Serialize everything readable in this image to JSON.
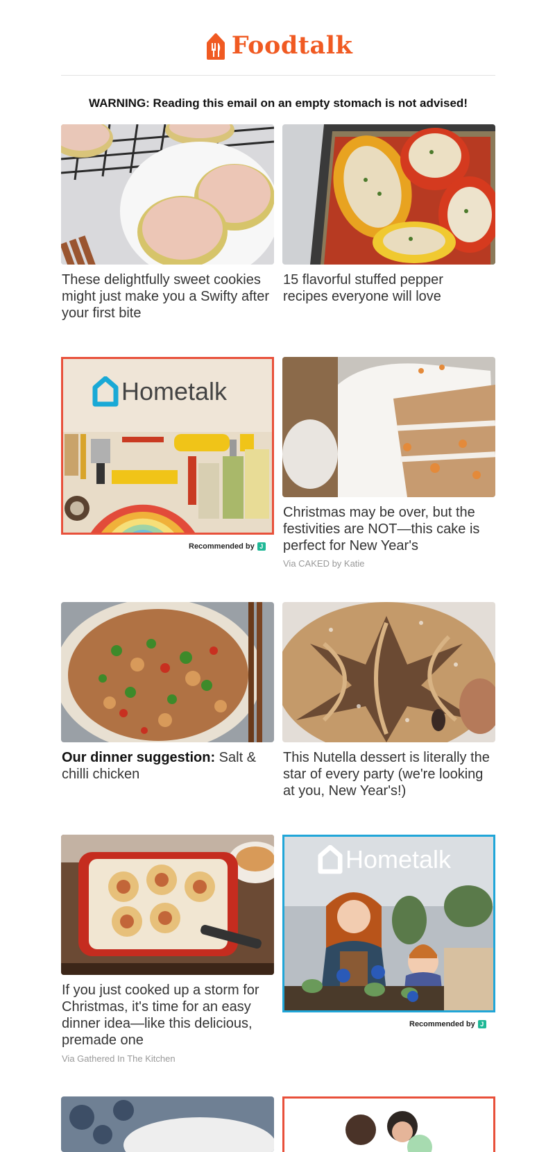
{
  "header": {
    "brand": "Foodtalk",
    "brand_color": "#f05a22"
  },
  "warning": "WARNING: Reading this email on an empty stomach is not advised!",
  "cards": [
    {
      "title": "These delightfully sweet cookies might just make you a Swifty after your first bite"
    },
    {
      "title": "15 flavorful stuffed pepper recipes everyone will love"
    },
    {
      "title": "Christmas may be over, but the festivities are NOT—this cake is perfect for New Year's",
      "via": "Via CAKED by Katie"
    },
    {
      "title_bold": "Our dinner suggestion:",
      "title": " Salt & chilli chicken"
    },
    {
      "title": "This Nutella dessert is literally the star of every party (we're looking at you, New Year's!)"
    },
    {
      "title": "If you just cooked up a storm for Christmas, it's time for an easy dinner idea—like this delicious, premade one",
      "via": "Via Gathered In The Kitchen"
    }
  ],
  "ads": [
    {
      "brand": "Hometalk",
      "recommended": "Recommended by",
      "badge": "J",
      "frame_color": "#e8503a"
    },
    {
      "brand": "Hometalk",
      "recommended": "Recommended by",
      "badge": "J",
      "frame_color": "#20a6d8"
    }
  ],
  "icons": {
    "brand_logo": "chef-hat-fork-icon",
    "hometalk_logo": "house-icon"
  }
}
